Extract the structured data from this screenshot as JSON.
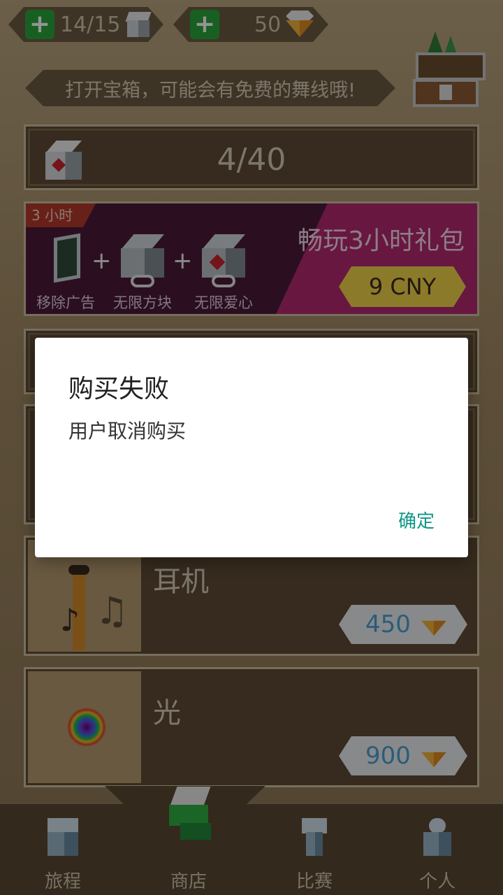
{
  "top_bar": {
    "cubes_count": "14/15",
    "gems_count": "50"
  },
  "banner": {
    "text": "打开宝箱，可能会有免费的舞线哦!"
  },
  "counter_row": {
    "value": "4/40"
  },
  "promo": {
    "tag": "3 小时",
    "title": "畅玩3小时礼包",
    "price": "9 CNY",
    "features": [
      "移除广告",
      "无限方块",
      "无限爱心"
    ],
    "plus": "+"
  },
  "items": [
    {
      "name": "耳机",
      "price": "450"
    },
    {
      "name": "光",
      "price": "900"
    }
  ],
  "nav": {
    "items": [
      "旅程",
      "商店",
      "比赛",
      "个人"
    ],
    "active": "商店"
  },
  "dialog": {
    "title": "购买失败",
    "message": "用户取消购买",
    "confirm": "确定"
  },
  "colors": {
    "accent_teal": "#0f9688",
    "promo_pink": "#b42970",
    "price_yellow": "#f2d24a",
    "plus_green": "#2aa53a"
  },
  "icons": [
    "plus-icon",
    "cube-icon",
    "gem-icon",
    "treasure-chest-icon",
    "heart-cube-icon",
    "ad-remove-icon",
    "infinite-cube-icon",
    "infinite-heart-icon",
    "headphones-icon",
    "light-orb-icon",
    "journey-icon",
    "shop-icon",
    "trophy-icon",
    "person-icon"
  ]
}
